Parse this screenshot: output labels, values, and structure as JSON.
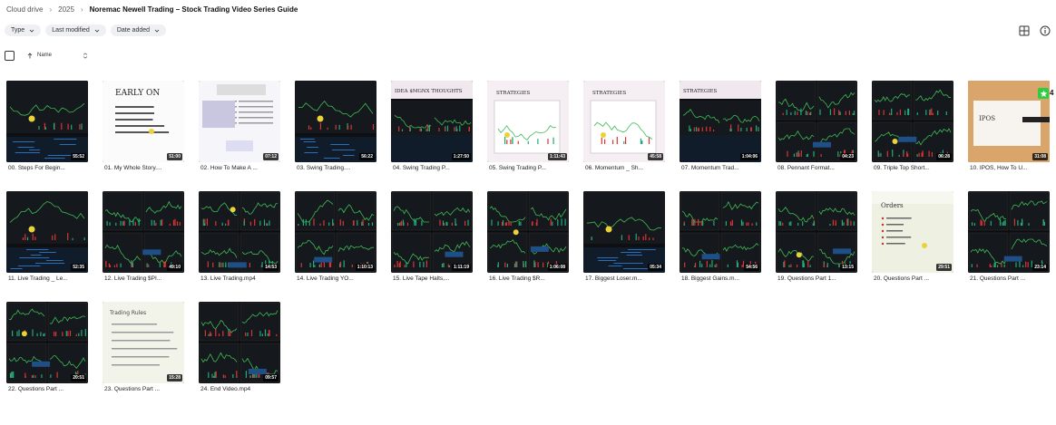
{
  "breadcrumb": {
    "root": "Cloud drive",
    "year": "2025",
    "current": "Noremac Newell Trading – Stock Trading Video Series Guide"
  },
  "filters": {
    "type": "Type",
    "last_modified": "Last modified",
    "date_added": "Date added"
  },
  "list_header": {
    "sort_label": "Name"
  },
  "icons": {
    "grid_view": "grid-view-icon",
    "info": "info-icon"
  },
  "colors": {
    "accent_green": "#2ecc40",
    "chip_bg": "#eef0f3"
  },
  "badge": {
    "count": "4"
  },
  "files": [
    {
      "name": "00. Steps For Begin...",
      "duration": "55:52",
      "style": "chart"
    },
    {
      "name": "01. My Whole Story....",
      "duration": "51:00",
      "style": "slide",
      "title": "EARLY ON"
    },
    {
      "name": "02. How To Make A ...",
      "duration": "07:12",
      "style": "doc"
    },
    {
      "name": "03. Swing Trading....",
      "duration": "56:22",
      "style": "dark"
    },
    {
      "name": "04. Swing Trading P...",
      "duration": "1:27:50",
      "style": "slidedark",
      "title": "IDEA $MGNX THOUGHTS"
    },
    {
      "name": "05. Swing Trading P...",
      "duration": "1:11:43",
      "style": "slidechart",
      "title": "STRATEGIES"
    },
    {
      "name": "06. Momentum _ Sh...",
      "duration": "45:58",
      "style": "slidechart",
      "title": "STRATEGIES"
    },
    {
      "name": "07. Momentum Trad...",
      "duration": "1:04:06",
      "style": "slidedark",
      "title": "STRATEGIES"
    },
    {
      "name": "08. Pennant Format...",
      "duration": "04:23",
      "style": "multi"
    },
    {
      "name": "09. Triple Top Short...",
      "duration": "06:28",
      "style": "multi"
    },
    {
      "name": "10. IPOS, How To U...",
      "duration": "31:08",
      "style": "ipos",
      "title": "IPOS"
    },
    {
      "name": "11. Live Trading _ Le...",
      "duration": "52:35",
      "style": "chart"
    },
    {
      "name": "12. Live Trading $PI...",
      "duration": "49:10",
      "style": "multi"
    },
    {
      "name": "13. Live Trading.mp4",
      "duration": "14:53",
      "style": "multi"
    },
    {
      "name": "14. Live Trading YO...",
      "duration": "1:10:13",
      "style": "multi"
    },
    {
      "name": "15. Live Tape Halts,...",
      "duration": "1:11:19",
      "style": "multi"
    },
    {
      "name": "16. Live Trading $R...",
      "duration": "1:06:08",
      "style": "multi"
    },
    {
      "name": "17. Biggest Loser.m...",
      "duration": "05:34",
      "style": "chart"
    },
    {
      "name": "18. Biggest Gains.m...",
      "duration": "54:56",
      "style": "multi"
    },
    {
      "name": "19. Questions Part 1...",
      "duration": "13:15",
      "style": "multi"
    },
    {
      "name": "20. Questions Part ...",
      "duration": "29:51",
      "style": "orders",
      "title": "Orders"
    },
    {
      "name": "21. Questions Part ...",
      "duration": "23:14",
      "style": "multi"
    },
    {
      "name": "22. Questions Part ...",
      "duration": "20:51",
      "style": "multi"
    },
    {
      "name": "23. Questions Part ...",
      "duration": "15:28",
      "style": "rules",
      "title": "Trading Rules"
    },
    {
      "name": "24. End Video.mp4",
      "duration": "09:57",
      "style": "multi"
    }
  ]
}
